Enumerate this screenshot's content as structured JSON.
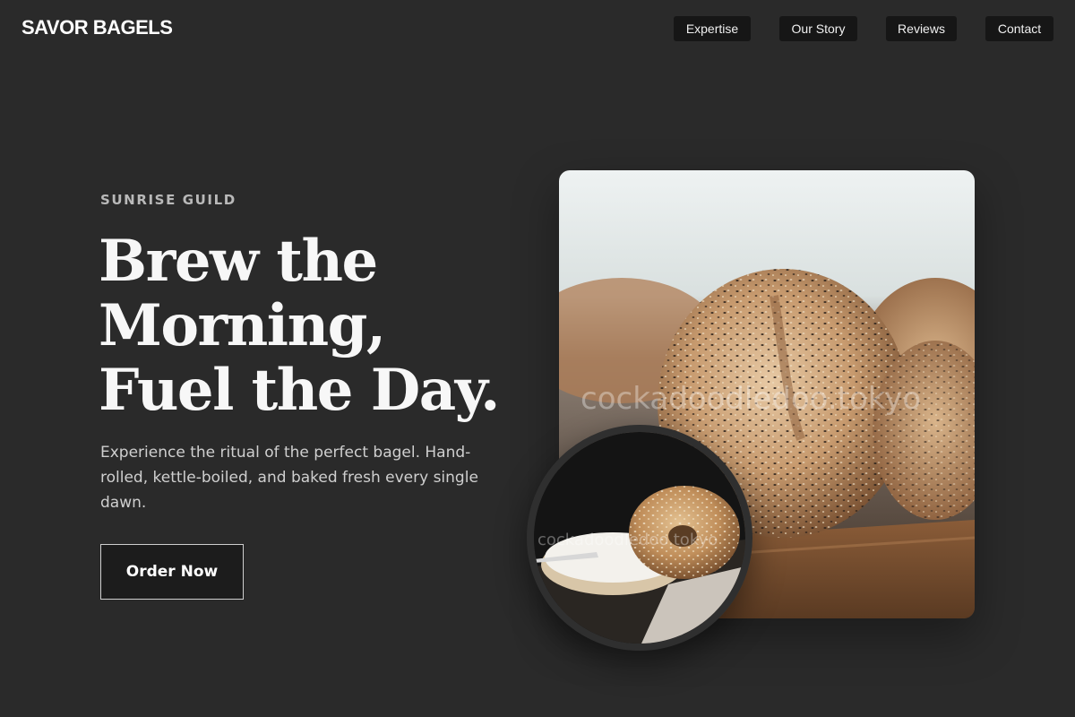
{
  "brand": {
    "name": "SAVOR BAGELS"
  },
  "nav": {
    "items": [
      {
        "label": "Expertise"
      },
      {
        "label": "Our Story"
      },
      {
        "label": "Reviews"
      },
      {
        "label": "Contact"
      }
    ]
  },
  "hero": {
    "eyebrow": "SUNRISE GUILD",
    "headline_lines": [
      "Brew the",
      "Morning,",
      "Fuel the Day."
    ],
    "lede": "Experience the ritual of the perfect bagel. Hand-rolled, kettle-boiled, and baked fresh every single dawn.",
    "cta_label": "Order Now"
  },
  "images": {
    "main": {
      "subject": "seeded-bagels-on-board",
      "watermark": "cockadoodledoo.tokyo"
    },
    "inset": {
      "subject": "bagel-with-cream-cheese",
      "watermark": "cockadoodledoo.tokyo"
    }
  },
  "colors": {
    "background": "#2a2a2a",
    "nav_pill": "#161616",
    "button_bg": "#1c1c1c",
    "text_primary": "#f7f7f7",
    "text_muted": "#cfcfcf"
  }
}
